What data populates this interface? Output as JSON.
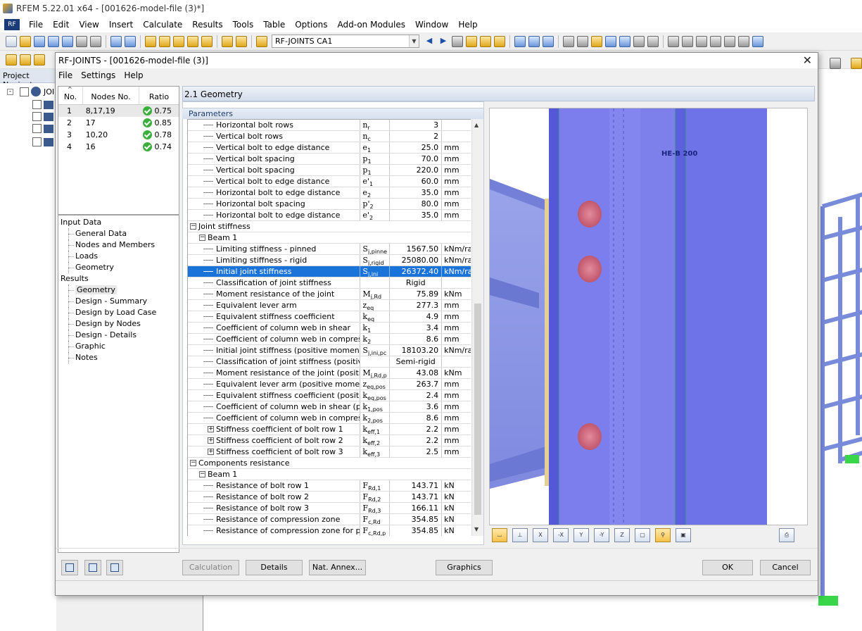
{
  "app": {
    "title": "RFEM 5.22.01 x64 - [001626-model-file (3)*]",
    "menu": [
      "File",
      "Edit",
      "View",
      "Insert",
      "Calculate",
      "Results",
      "Tools",
      "Table",
      "Options",
      "Add-on Modules",
      "Window",
      "Help"
    ],
    "load_case_combo": "RF-JOINTS CA1"
  },
  "navigator": {
    "title": "Project Navigat",
    "root_label": "JOI"
  },
  "dialog": {
    "title": "RF-JOINTS - [001626-model-file (3)]",
    "menu": [
      "File",
      "Settings",
      "Help"
    ],
    "joints_table": {
      "headers": [
        "No.",
        "Nodes No.",
        "Ratio"
      ],
      "rows": [
        {
          "no": "1",
          "nodes": "8,17,19",
          "ratio": "0.75"
        },
        {
          "no": "2",
          "nodes": "17",
          "ratio": "0.85"
        },
        {
          "no": "3",
          "nodes": "10,20",
          "ratio": "0.78"
        },
        {
          "no": "4",
          "nodes": "16",
          "ratio": "0.74"
        }
      ]
    },
    "tree": {
      "input_label": "Input Data",
      "input_items": [
        "General Data",
        "Nodes and Members",
        "Loads",
        "Geometry"
      ],
      "results_label": "Results",
      "results_items": [
        "Geometry",
        "Design - Summary",
        "Design by Load Case",
        "Design by Nodes",
        "Design - Details",
        "Graphic",
        "Notes"
      ]
    },
    "section_title": "2.1 Geometry",
    "params_tab": "Parameters",
    "params": [
      {
        "type": "row",
        "name": "Horizontal bolt rows",
        "sym": "n",
        "sub": "r",
        "val": "3",
        "unit": ""
      },
      {
        "type": "row",
        "name": "Vertical bolt rows",
        "sym": "n",
        "sub": "c",
        "val": "2",
        "unit": ""
      },
      {
        "type": "row",
        "name": "Vertical bolt to edge distance",
        "sym": "e",
        "sub": "1",
        "val": "25.0",
        "unit": "mm"
      },
      {
        "type": "row",
        "name": "Vertical bolt spacing",
        "sym": "p",
        "sub": "1",
        "val": "70.0",
        "unit": "mm"
      },
      {
        "type": "row",
        "name": "Vertical bolt spacing",
        "sym": "p",
        "sub": "1",
        "val": "220.0",
        "unit": "mm"
      },
      {
        "type": "row",
        "name": "Vertical bolt to edge distance",
        "sym": "e'",
        "sub": "1",
        "val": "60.0",
        "unit": "mm"
      },
      {
        "type": "row",
        "name": "Horizontal bolt to edge distance",
        "sym": "e",
        "sub": "2",
        "val": "35.0",
        "unit": "mm"
      },
      {
        "type": "row",
        "name": "Horizontal bolt spacing",
        "sym": "p'",
        "sub": "2",
        "val": "80.0",
        "unit": "mm"
      },
      {
        "type": "row",
        "name": "Horizontal bolt to edge distance",
        "sym": "e'",
        "sub": "2",
        "val": "35.0",
        "unit": "mm"
      },
      {
        "type": "group0",
        "name": "Joint stiffness"
      },
      {
        "type": "group1",
        "name": "Beam 1"
      },
      {
        "type": "row",
        "name": "Limiting stiffness - pinned",
        "sym": "S",
        "sub": "j,pinne",
        "val": "1567.50",
        "unit": "kNm/ra"
      },
      {
        "type": "row",
        "name": "Limiting stiffness - rigid",
        "sym": "S",
        "sub": "j,rigid",
        "val": "25080.00",
        "unit": "kNm/ra"
      },
      {
        "type": "row",
        "name": "Initial joint stiffness",
        "sym": "S",
        "sub": "j,ini",
        "val": "26372.40",
        "unit": "kNm/ra",
        "selected": true
      },
      {
        "type": "row",
        "name": "Classification of joint stiffness",
        "sym": "",
        "sub": "",
        "val": "Rigid",
        "unit": "",
        "center": true
      },
      {
        "type": "row",
        "name": "Moment resistance of the joint",
        "sym": "M",
        "sub": "j,Rd",
        "val": "75.89",
        "unit": "kNm"
      },
      {
        "type": "row",
        "name": "Equivalent lever arm",
        "sym": "z",
        "sub": "eq",
        "val": "277.3",
        "unit": "mm"
      },
      {
        "type": "row",
        "name": "Equivalent stiffness coefficient",
        "sym": "k",
        "sub": "eq",
        "val": "4.9",
        "unit": "mm"
      },
      {
        "type": "row",
        "name": "Coefficient of column web in shear",
        "sym": "k",
        "sub": "1",
        "val": "3.4",
        "unit": "mm"
      },
      {
        "type": "row",
        "name": "Coefficient of column web in compression",
        "sym": "k",
        "sub": "2",
        "val": "8.6",
        "unit": "mm"
      },
      {
        "type": "row",
        "name": "Initial joint stiffness (positive moment)",
        "sym": "S",
        "sub": "j,ini,pc",
        "val": "18103.20",
        "unit": "kNm/ra"
      },
      {
        "type": "row",
        "name": "Classification of joint stiffness (positive mom",
        "sym": "",
        "sub": "",
        "val": "Semi-rigid",
        "unit": "",
        "center": true
      },
      {
        "type": "row",
        "name": "Moment resistance of the joint (positive mor",
        "sym": "M",
        "sub": "j,Rd,p",
        "val": "43.08",
        "unit": "kNm"
      },
      {
        "type": "row",
        "name": "Equivalent lever arm (positive moment)",
        "sym": "z",
        "sub": "eq,pos",
        "val": "263.7",
        "unit": "mm"
      },
      {
        "type": "row",
        "name": "Equivalent stiffness coefficient (positive mo",
        "sym": "k",
        "sub": "eq,pos",
        "val": "2.4",
        "unit": "mm"
      },
      {
        "type": "row",
        "name": "Coefficient of column web in shear (positive",
        "sym": "k",
        "sub": "1,pos",
        "val": "3.6",
        "unit": "mm"
      },
      {
        "type": "row",
        "name": "Coefficient of column web in compression (",
        "sym": "k",
        "sub": "2,pos",
        "val": "8.6",
        "unit": "mm"
      },
      {
        "type": "rowx",
        "name": "Stiffness coefficient of bolt row 1",
        "sym": "k",
        "sub": "eff,1",
        "val": "2.2",
        "unit": "mm"
      },
      {
        "type": "rowx",
        "name": "Stiffness coefficient of bolt row 2",
        "sym": "k",
        "sub": "eff,2",
        "val": "2.2",
        "unit": "mm"
      },
      {
        "type": "rowx",
        "name": "Stiffness coefficient of bolt row 3",
        "sym": "k",
        "sub": "eff,3",
        "val": "2.5",
        "unit": "mm"
      },
      {
        "type": "group0",
        "name": "Components resistance"
      },
      {
        "type": "group1",
        "name": "Beam 1"
      },
      {
        "type": "row",
        "name": "Resistance of bolt row 1",
        "sym": "F",
        "sub": "Rd,1",
        "val": "143.71",
        "unit": "kN"
      },
      {
        "type": "row",
        "name": "Resistance of bolt row 2",
        "sym": "F",
        "sub": "Rd,2",
        "val": "143.71",
        "unit": "kN"
      },
      {
        "type": "row",
        "name": "Resistance of bolt row 3",
        "sym": "F",
        "sub": "Rd,3",
        "val": "166.11",
        "unit": "kN"
      },
      {
        "type": "row",
        "name": "Resistance of compression zone",
        "sym": "F",
        "sub": "c,Rd",
        "val": "354.85",
        "unit": "kN"
      },
      {
        "type": "row",
        "name": "Resistance of compression zone for positiv",
        "sym": "F",
        "sub": "c,Rd,p",
        "val": "354.85",
        "unit": "kN"
      }
    ],
    "graphic_label": "HE-B 200",
    "buttons": {
      "calculation": "Calculation",
      "details": "Details",
      "nat_annex": "Nat. Annex...",
      "graphics": "Graphics",
      "ok": "OK",
      "cancel": "Cancel"
    }
  }
}
